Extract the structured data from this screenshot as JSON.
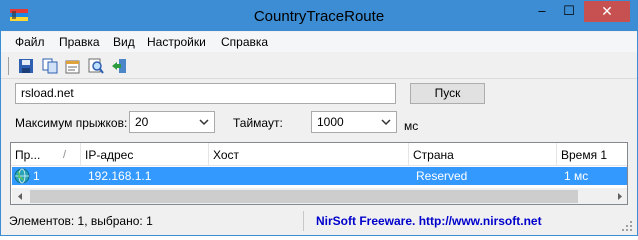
{
  "window": {
    "title": "CountryTraceRoute",
    "minimize_label": "–",
    "maximize_label": "☐",
    "close_label": "✕"
  },
  "menu": [
    "Файл",
    "Правка",
    "Вид",
    "Настройки",
    "Справка"
  ],
  "toolbar": {
    "icons": [
      "save-icon",
      "copy-icon",
      "properties-icon",
      "find-icon",
      "exit-icon"
    ]
  },
  "form": {
    "host_value": "rsload.net",
    "run_button": "Пуск",
    "max_hops_label": "Максимум прыжков:",
    "max_hops_value": "20",
    "timeout_label": "Таймаут:",
    "timeout_value": "1000",
    "timeout_unit": "мс"
  },
  "table": {
    "columns": [
      "Пр...",
      "IP-адрес",
      "Хост",
      "Страна",
      "Время 1"
    ],
    "sort_indicator": "/",
    "rows": [
      {
        "hop": "1",
        "ip": "192.168.1.1",
        "host": "",
        "country": "Reserved",
        "time1": "1 мс",
        "selected": true
      }
    ]
  },
  "status": {
    "items_text": "Элементов: 1, выбрано: 1",
    "credit_text": "NirSoft Freeware.  http://www.nirsoft.net"
  },
  "colors": {
    "titlebar": "#3c8dd4",
    "close_button": "#c75050",
    "selection": "#3399ff",
    "link": "#0000cc"
  }
}
